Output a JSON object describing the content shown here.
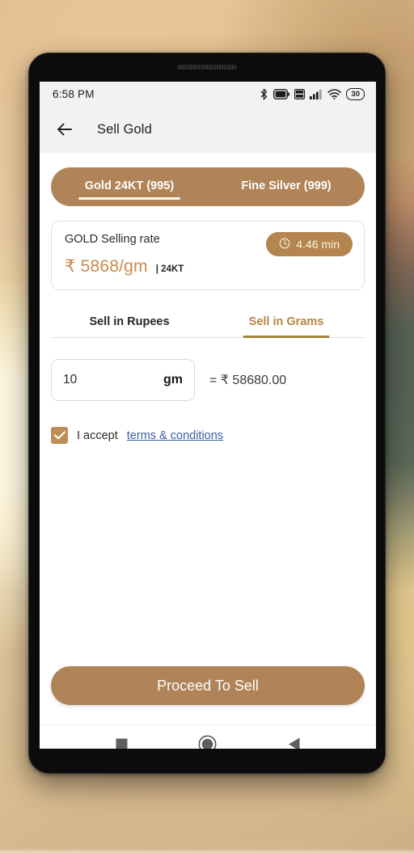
{
  "statusbar": {
    "time": "6:58 PM",
    "icons": [
      "bluetooth-icon",
      "battery-icon",
      "volte-icon",
      "signal-icon",
      "wifi-icon"
    ],
    "battery_percent": "30"
  },
  "appbar": {
    "back_icon": "back-arrow-icon",
    "title": "Sell Gold"
  },
  "metal_tabs": [
    {
      "label": "Gold 24KT (995)",
      "active": true
    },
    {
      "label": "Fine Silver (999)",
      "active": false
    }
  ],
  "rate_card": {
    "label": "GOLD Selling rate",
    "timer_icon": "clock-icon",
    "timer_text": "4.46 min",
    "price": "₹ 5868/gm",
    "purity": "| 24KT"
  },
  "mode_tabs": [
    {
      "label": "Sell in Rupees",
      "active": false
    },
    {
      "label": "Sell in Grams",
      "active": true
    }
  ],
  "amount": {
    "value": "10",
    "placeholder": "0",
    "unit": "gm",
    "converted": "= ₹ 58680.00"
  },
  "terms": {
    "checked": true,
    "text": "I accept ",
    "link_label": "terms & conditions"
  },
  "cta": {
    "label": "Proceed To Sell"
  },
  "navbar": {
    "recents": "recents-square-icon",
    "home": "home-circle-icon",
    "back": "back-triangle-icon"
  },
  "colors": {
    "brand_brown": "#b08458",
    "timer_brown": "#b4854f",
    "price_orange": "#c98a4b",
    "active_tab_gold": "#b5863f",
    "link_blue": "#3a5fa0",
    "checkbox_tan": "#bf8e56",
    "statusbar_gray": "#f2f2f2"
  }
}
